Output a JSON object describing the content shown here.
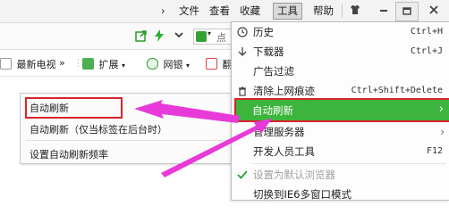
{
  "menubar": {
    "chevron": "›",
    "file": "文件",
    "view": "查看",
    "favorites": "收藏",
    "tools": "工具",
    "help": "帮助"
  },
  "addressbar": {
    "search_partial": "点"
  },
  "bookmarks": {
    "item1": "最新电视",
    "more": "»",
    "extension": "扩展",
    "bank": "网银",
    "translate_partial": "翻"
  },
  "submenu": {
    "items": [
      "自动刷新",
      "自动刷新（仅当标签在后台时）",
      "设置自动刷新频率"
    ]
  },
  "tools_menu": {
    "items": [
      {
        "label": "历史",
        "shortcut": "Ctrl+H",
        "icon": "clock-icon"
      },
      {
        "label": "下载器",
        "shortcut": "Ctrl+J",
        "icon": "download-icon"
      },
      {
        "label": "广告过滤",
        "shortcut": "",
        "icon": ""
      },
      {
        "label": "清除上网痕迹",
        "shortcut": "Ctrl+Shift+Delete",
        "icon": "trash-icon"
      },
      {
        "label": "自动刷新",
        "shortcut": "",
        "icon": ""
      },
      {
        "label": "管理服务器",
        "shortcut": "",
        "icon": ""
      },
      {
        "label": "开发人员工具",
        "shortcut": "F12",
        "icon": ""
      },
      {
        "label": "设置为默认浏览器",
        "shortcut": "",
        "icon": "check-icon"
      },
      {
        "label": "切换到IE6多窗口模式",
        "shortcut": "",
        "icon": ""
      }
    ]
  },
  "colors": {
    "highlight_green": "#3db53d",
    "callout_red": "#d8232a",
    "arrow_magenta": "#e83ad8"
  }
}
